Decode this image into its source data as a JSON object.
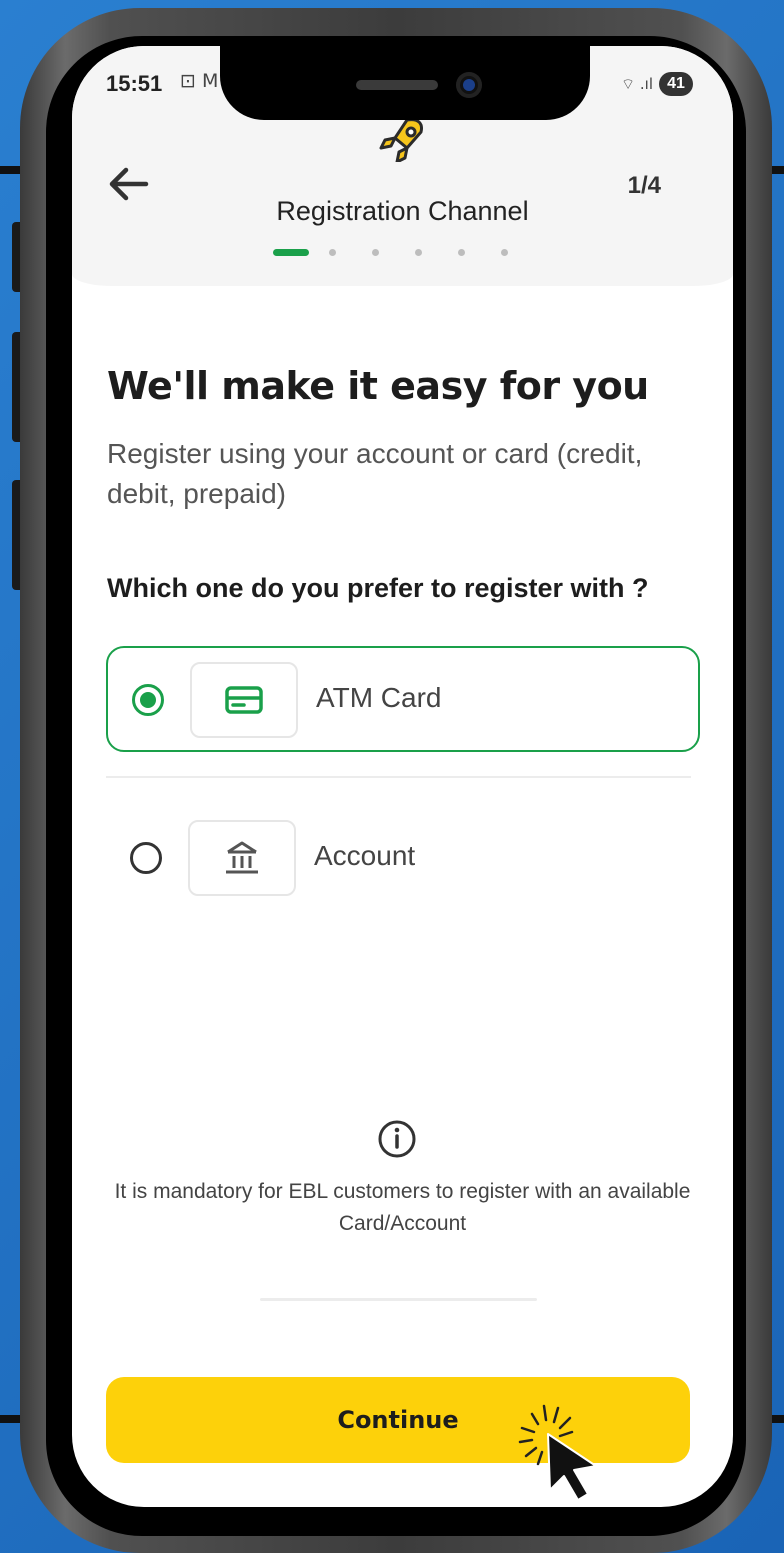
{
  "status_bar": {
    "time": "15:51",
    "left_icons": "⊡ M",
    "signal": "⌔ .ıl",
    "battery": "41"
  },
  "header": {
    "title": "Registration Channel",
    "step": "1/4",
    "dots_total": 6,
    "dots_active_index": 0
  },
  "content": {
    "heading": "We'll make it easy for you",
    "subtext": "Register using your account or card (credit, debit, prepaid)",
    "question": "Which one do you prefer to register with ?",
    "options": [
      {
        "label": "ATM Card",
        "icon": "card-icon",
        "selected": true
      },
      {
        "label": "Account",
        "icon": "bank-icon",
        "selected": false
      }
    ],
    "info_text": "It is mandatory for EBL customers to register with an available Card/Account"
  },
  "cta": {
    "label": "Continue"
  },
  "colors": {
    "accent_green": "#1aa04a",
    "cta_yellow": "#fdd10a",
    "background_blue": "#1f6fc0"
  }
}
